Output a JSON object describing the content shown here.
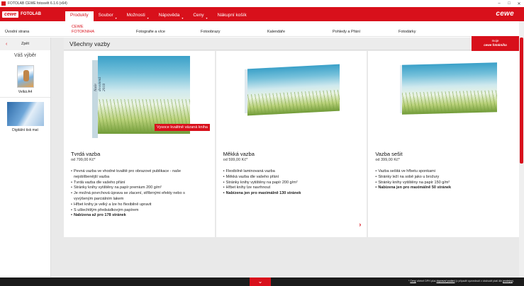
{
  "window": {
    "title": "FOTOLAB CEWE fotosvět 6.1.6 (x64)",
    "controls": [
      "–",
      "□",
      "✕"
    ]
  },
  "brand": {
    "cewe": "cewe",
    "fotolab": "FOTOLAB",
    "logo_right": "cewe"
  },
  "menu": [
    {
      "label": "Produkty",
      "active": true
    },
    {
      "label": "Soubor",
      "arrow": "▾"
    },
    {
      "label": "Možnosti",
      "arrow": "▾"
    },
    {
      "label": "Nápověda",
      "arrow": "▾"
    },
    {
      "label": "Ceny",
      "arrow": "▾"
    },
    {
      "label": "Nákupní košík"
    }
  ],
  "subnav": {
    "home": "Úvodní strana",
    "active_line1": "CEWE",
    "active_line2": "FOTOKNIHA",
    "tabs": [
      "Fotografie a více",
      "Fotoobrazy",
      "Kalendáře",
      "Pohledy a Přání",
      "Fotodárky"
    ]
  },
  "sidebar": {
    "back": "Zpět",
    "back_icon": "‹",
    "selection_title": "Váš výběr",
    "items": [
      {
        "label": "Velká A4"
      },
      {
        "label": "Digitální tisk mat"
      }
    ]
  },
  "main": {
    "heading": "Všechny vazby",
    "badge_line1": "moje",
    "badge_line2": "cewe fotokniha"
  },
  "cards": [
    {
      "name": "Tvrdá vazba",
      "price": "od 799,00 Kč*",
      "spine_text": "Naše dovolená 2018",
      "promo": "Vysoce kvalitně vázaná kniha",
      "features": [
        "Pevná vazba ve vhodné kvalitě pro obrazové publikace - naše",
        "nejoblíbenější vazba",
        "Tvrdá vazba dle vašeho přání",
        "Stránky knihy vytištěny na papír premium 200 g/m²",
        "Je možná povrchová úprava se zlacení, stříbrnými efekty nebo s",
        "vyvýšeným parciálním lakem",
        "Hřbet knihy je velký a lze ho flexibilně upravit",
        "S ušlechtilým předsádkovým papírem",
        "Nabízena až pro 178 stránek"
      ]
    },
    {
      "name": "Měkká vazba",
      "price": "od 599,00 Kč*",
      "features": [
        "Flexibilně laminovaná vazba",
        "Měkká vazba dle vašeho přání",
        "Stránky knihy vytištěny na papír 200 g/m²",
        "Hřbet knihy lze navrhnout",
        "Nabízena jen pro maximálně 130 stránek"
      ],
      "next_icon": "›"
    },
    {
      "name": "Vazba sešit",
      "price": "od 399,00 Kč*",
      "features": [
        "Vazba sešitá ve hřbetu sponkami",
        "Stránky leží na sobě jako u brožury",
        "Stránky knihy vytištěny na papír 150 g/m²",
        "Nabízena jen pro maximálně 50 stránek"
      ]
    }
  ],
  "footer": {
    "chevron": "⌄",
    "note_a": "* ",
    "note_link1": "Ceny",
    "note_b": " včetně DPH plus ",
    "note_link2": "doprava/ podání",
    "note_c": " (v případě vyzvednutí v obchodě platí dle ",
    "note_link3": "prodejny",
    "note_d": ")."
  },
  "colors": {
    "brand_red": "#d8101b",
    "footer_bg": "#1b1b1b"
  }
}
